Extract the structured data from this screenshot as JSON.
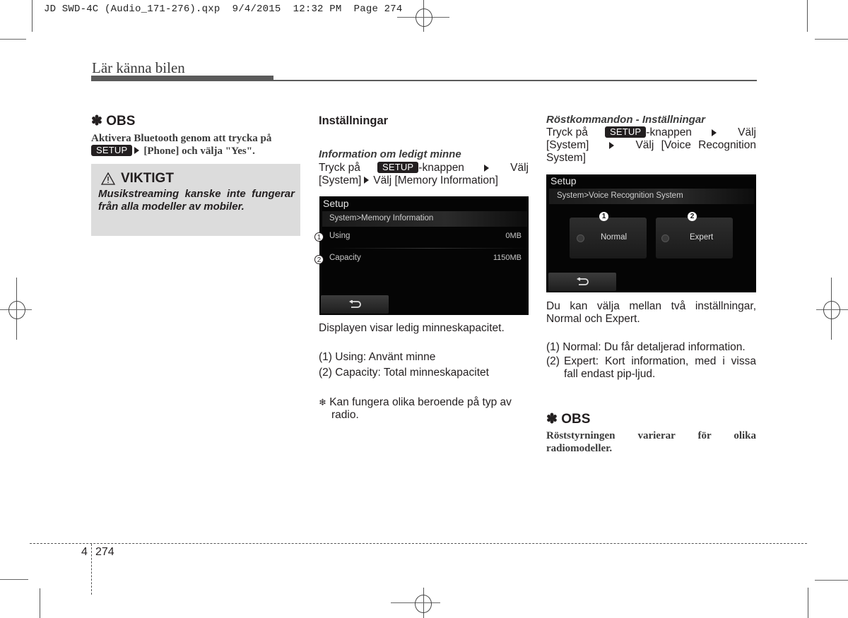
{
  "slug": "JD SWD-4C (Audio_171-276).qxp  9/4/2015  12:32 PM  Page 274",
  "running_head": "Lär känna bilen",
  "left_column": {
    "obs": {
      "icon": "asterisk-icon",
      "title": "✽ OBS",
      "text_before": "Aktivera Bluetooth genom att trycka på",
      "key": "SETUP",
      "text_after": "[Phone] och välja \"Yes\"."
    },
    "warning": {
      "icon": "warning-triangle-icon",
      "title": "VIKTIGT",
      "text": "Musikstreaming kanske inte fungerar från alla modeller av mobiler."
    }
  },
  "middle_column": {
    "heading": "Inställningar",
    "subheading": "Information om ledigt minne",
    "instr_line1_a": "Tryck på",
    "key": "SETUP",
    "instr_line1_b": "-knappen",
    "instr_line1_c": "Välj",
    "instr_line2_a": "[System]",
    "instr_line2_b": "Välj [Memory Information]",
    "screen": {
      "title": "Setup",
      "breadcrumb": "System>Memory Information",
      "rows": [
        {
          "callout": "1",
          "label": "Using",
          "value": "0MB"
        },
        {
          "callout": "2",
          "label": "Capacity",
          "value": "1150MB"
        }
      ],
      "back_icon": "back-arrow-icon"
    },
    "description": "Displayen visar ledig minneskapacitet.",
    "list": [
      "(1) Using: Använt minne",
      "(2) Capacity: Total minneskapacitet"
    ],
    "note_symbol": "❄",
    "note_line1": "Kan fungera olika beroende på typ av",
    "note_line2": "radio."
  },
  "right_column": {
    "subheading": "Röstkommandon - Inställningar",
    "instr_line1_a": "Tryck på",
    "key": "SETUP",
    "instr_line1_b": "-knappen",
    "instr_line1_c": "Välj",
    "instr_line2_a": "[System]",
    "instr_line2_b": "Välj [Voice Recognition",
    "instr_line3": "System]",
    "screen": {
      "title": "Setup",
      "breadcrumb": "System>Voice Recognition System",
      "options": [
        {
          "callout": "1",
          "label": "Normal"
        },
        {
          "callout": "2",
          "label": "Expert"
        }
      ],
      "back_icon": "back-arrow-icon"
    },
    "description_line1": "Du kan välja mellan två inställningar,",
    "description_line2": "Normal och Expert.",
    "list": [
      {
        "num": "(1)",
        "text": "Normal: Du får detaljerad information."
      },
      {
        "num": "(2)",
        "text_line1": "Expert: Kort information, med i vissa",
        "text_line2": "fall endast pip-ljud."
      }
    ],
    "obs": {
      "title": "✽ OBS",
      "text_line1": "Röststyrningen varierar för olika",
      "text_line2": "radiomodeller."
    }
  },
  "footer": {
    "chapter": "4",
    "page": "274"
  }
}
